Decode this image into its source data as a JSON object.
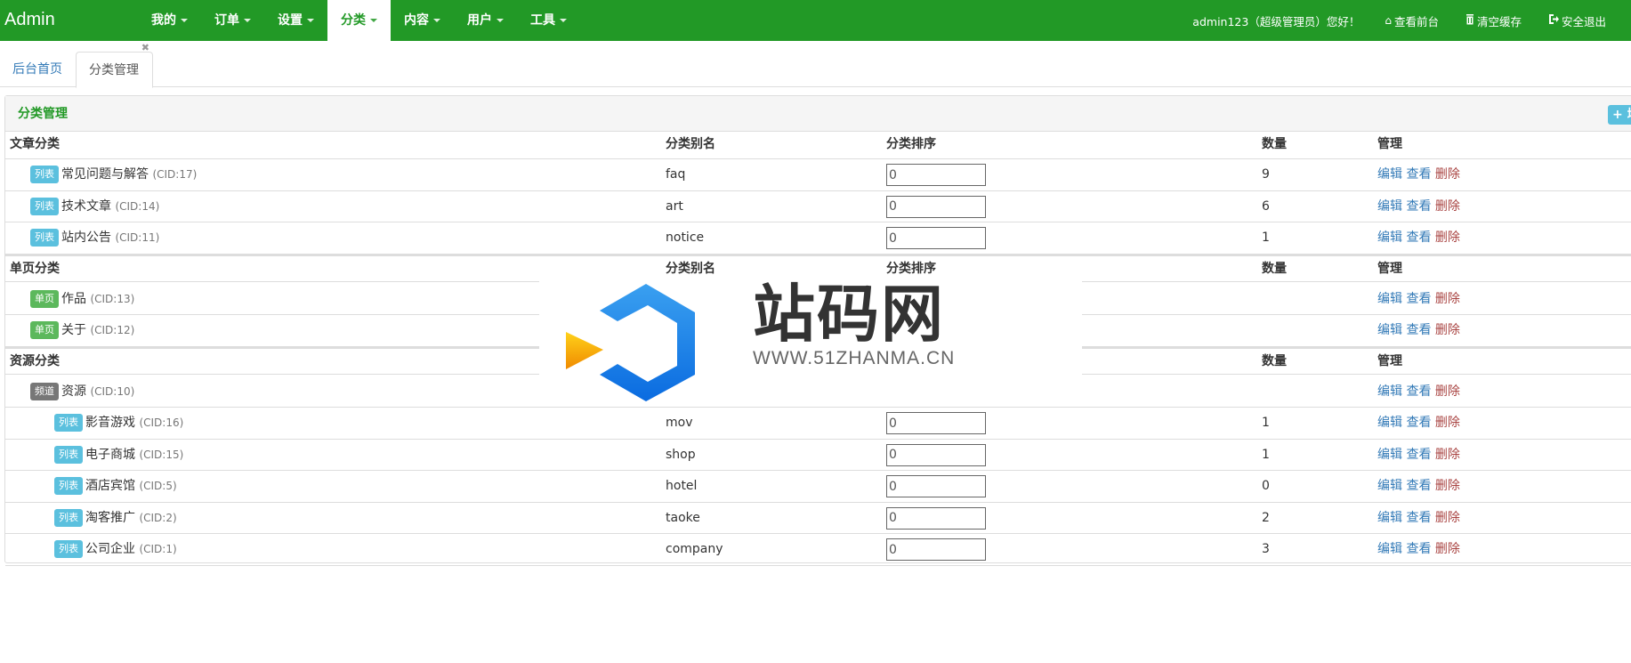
{
  "brand": "Admin",
  "nav": [
    {
      "label": "我的",
      "active": false
    },
    {
      "label": "订单",
      "active": false
    },
    {
      "label": "设置",
      "active": false
    },
    {
      "label": "分类",
      "active": true
    },
    {
      "label": "内容",
      "active": false
    },
    {
      "label": "用户",
      "active": false
    },
    {
      "label": "工具",
      "active": false
    }
  ],
  "user": {
    "greeting": "admin123（超级管理员）您好！",
    "links": [
      {
        "icon": "home-icon",
        "glyph": "⌂",
        "label": "查看前台"
      },
      {
        "icon": "trash-icon",
        "glyph": "🗑",
        "label": "清空缓存"
      },
      {
        "icon": "logout-icon",
        "glyph": "⇥",
        "label": "安全退出"
      }
    ]
  },
  "tabs": {
    "home": "后台首页",
    "current": "分类管理",
    "close_glyph": "✖"
  },
  "panel": {
    "title": "分类管理",
    "add_label": "+ 增"
  },
  "columns": {
    "alias": "分类别名",
    "sort": "分类排序",
    "count": "数量",
    "manage": "管理"
  },
  "actions": {
    "edit": "编辑",
    "view": "查看",
    "delete": "删除"
  },
  "groups": [
    {
      "title": "文章分类",
      "items": [
        {
          "type": "列表",
          "kind": "list",
          "name": "常见问题与解答",
          "cid": "(CID:17)",
          "alias": "faq",
          "sort": "0",
          "count": "9",
          "indent": 1
        },
        {
          "type": "列表",
          "kind": "list",
          "name": "技术文章",
          "cid": "(CID:14)",
          "alias": "art",
          "sort": "0",
          "count": "6",
          "indent": 1
        },
        {
          "type": "列表",
          "kind": "list",
          "name": "站内公告",
          "cid": "(CID:11)",
          "alias": "notice",
          "sort": "0",
          "count": "1",
          "indent": 1
        }
      ]
    },
    {
      "title": "单页分类",
      "items": [
        {
          "type": "单页",
          "kind": "page",
          "name": "作品",
          "cid": "(CID:13)",
          "alias": "",
          "sort": "",
          "count": "",
          "indent": 1
        },
        {
          "type": "单页",
          "kind": "page",
          "name": "关于",
          "cid": "(CID:12)",
          "alias": "",
          "sort": "",
          "count": "",
          "indent": 1
        }
      ]
    },
    {
      "title": "资源分类",
      "items": [
        {
          "type": "频道",
          "kind": "chan",
          "name": "资源",
          "cid": "(CID:10)",
          "alias": "",
          "sort": "",
          "count": "",
          "indent": 1
        },
        {
          "type": "列表",
          "kind": "list",
          "name": "影音游戏",
          "cid": "(CID:16)",
          "alias": "mov",
          "sort": "0",
          "count": "1",
          "indent": 2
        },
        {
          "type": "列表",
          "kind": "list",
          "name": "电子商城",
          "cid": "(CID:15)",
          "alias": "shop",
          "sort": "0",
          "count": "1",
          "indent": 2
        },
        {
          "type": "列表",
          "kind": "list",
          "name": "酒店宾馆",
          "cid": "(CID:5)",
          "alias": "hotel",
          "sort": "0",
          "count": "0",
          "indent": 2
        },
        {
          "type": "列表",
          "kind": "list",
          "name": "淘客推广",
          "cid": "(CID:2)",
          "alias": "taoke",
          "sort": "0",
          "count": "2",
          "indent": 2
        },
        {
          "type": "列表",
          "kind": "list",
          "name": "公司企业",
          "cid": "(CID:1)",
          "alias": "company",
          "sort": "0",
          "count": "3",
          "indent": 2
        }
      ]
    }
  ],
  "watermark": {
    "title": "站码网",
    "url": "WWW.51ZHANMA.CN"
  },
  "colors": {
    "nav_bg": "#229926",
    "accent": "#229926",
    "label_list": "#5bc0de",
    "label_page": "#5cb85c",
    "label_channel": "#777777",
    "link": "#337ab7",
    "danger": "#a94442"
  }
}
